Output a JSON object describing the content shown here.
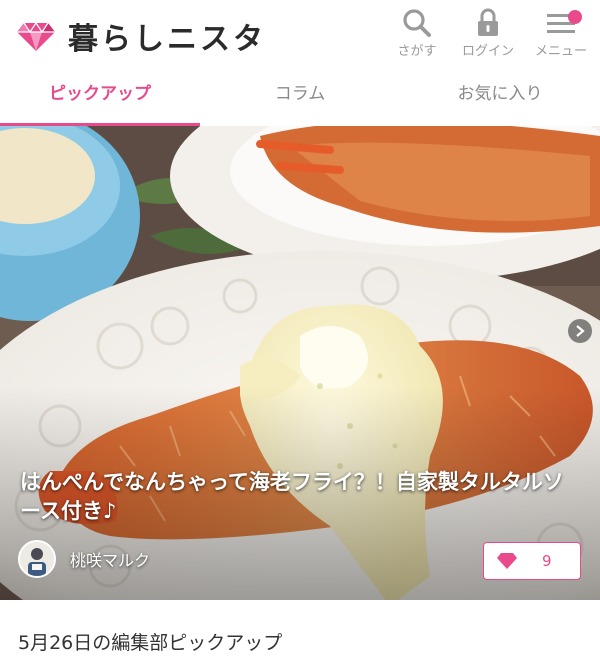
{
  "header": {
    "logo_text": "暮らしニスタ",
    "buttons": [
      {
        "label": "さがす",
        "icon": "search-icon"
      },
      {
        "label": "ログイン",
        "icon": "lock-icon"
      },
      {
        "label": "メニュー",
        "icon": "menu-icon"
      }
    ]
  },
  "tabs": [
    {
      "label": "ピックアップ",
      "active": true
    },
    {
      "label": "コラム",
      "active": false
    },
    {
      "label": "お気に入り",
      "active": false
    }
  ],
  "hero": {
    "title": "はんぺんでなんちゃって海老フライ？！自家製タルタルソース付き♪",
    "author": "桃咲マルク",
    "like_count": "9"
  },
  "section": {
    "title": "5月26日の編集部ピックアップ"
  },
  "colors": {
    "accent": "#e84a8c",
    "text": "#333333",
    "muted": "#9a9a9a"
  }
}
